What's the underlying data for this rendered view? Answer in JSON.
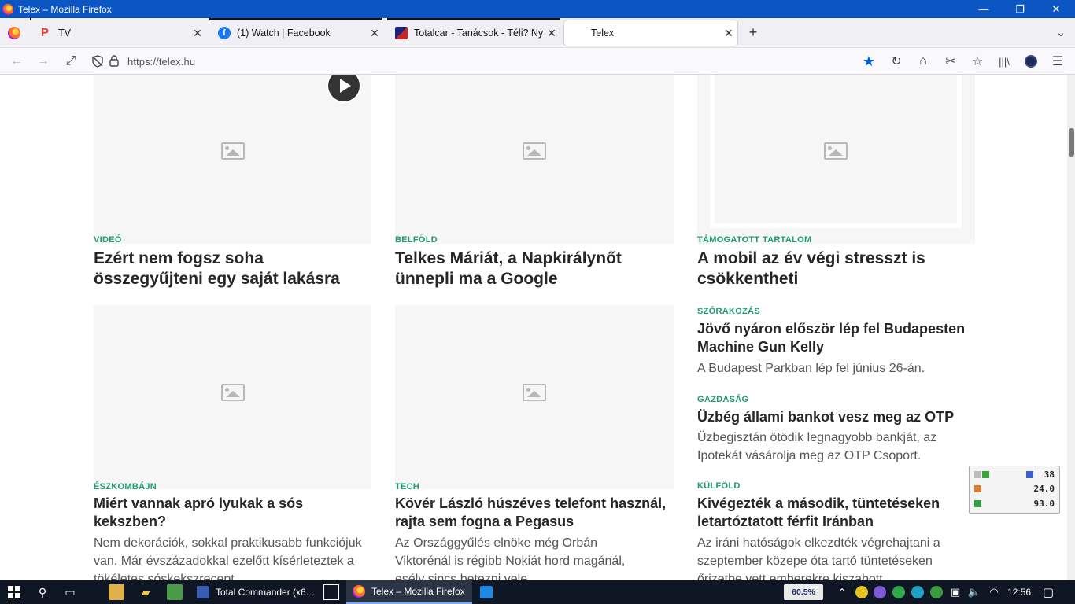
{
  "window": {
    "title": "Telex – Mozilla Firefox",
    "controls": {
      "minimize": "—",
      "restore": "❐",
      "close": "✕"
    }
  },
  "tabs": [
    {
      "title": "TV",
      "favicon": "p-logo-icon"
    },
    {
      "title": "(1) Watch | Facebook",
      "favicon": "facebook-icon"
    },
    {
      "title": "Totalcar - Tanácsok - Téli? Nyári",
      "favicon": "totalcar-icon"
    },
    {
      "title": "Telex",
      "favicon": "telex-icon",
      "active": true
    }
  ],
  "navbar": {
    "url": "https://telex.hu",
    "bookmarked": true,
    "accent": "#0060df"
  },
  "articles": [
    {
      "category": "VIDEÓ",
      "headline": "Ezért nem fogsz soha összegyűjteni egy saját lakásra",
      "has_video": true
    },
    {
      "category": "BELFÖLD",
      "headline": "Telkes Máriát, a Napkirálynőt ünnepli ma a Google"
    },
    {
      "category": "TÁMOGATOTT TARTALOM",
      "headline": "A mobil az év végi stresszt is csökkentheti"
    },
    {
      "category": "SZÓRAKOZÁS",
      "headline": "Jövő nyáron először lép fel Budapesten Machine Gun Kelly",
      "lead": "A Budapest Parkban lép fel június 26-án."
    },
    {
      "category": "GAZDASÁG",
      "headline": "Üzbég állami bankot vesz meg az OTP",
      "lead": "Üzbegisztán ötödik legnagyobb bankját, az Ipotekát vásárolja meg az OTP Csoport."
    },
    {
      "category": "ÉSZKOMBÁJN",
      "headline": "Miért vannak apró lyukak a sós kekszben?",
      "lead": "Nem dekorációk, sokkal praktikusabb funkciójuk van. Már évszázadokkal ezelőtt kísérleteztek a tökéletes sóskekszrecept"
    },
    {
      "category": "TECH",
      "headline": "Kövér László húszéves telefont használ, rajta sem fogna a Pegasus",
      "lead": "Az Országgyűlés elnöke még Orbán Viktorénál is régibb Nokiát hord magánál, esély sincs betezni vele"
    },
    {
      "category": "KÜLFÖLD",
      "headline": "Kivégezték a második, tüntetéseken letartóztatott férfit Iránban",
      "lead": "Az iráni hatóságok elkezdték végrehajtani a szeptember közepe óta tartó tüntetéseken őrizetbe vett emberekre kiszabott"
    }
  ],
  "gadget": {
    "values": [
      "38",
      "24.0",
      "93.0"
    ]
  },
  "taskbar": {
    "apps": [
      {
        "label": "Total Commander (x6…",
        "active": false
      },
      {
        "label": "Telex – Mozilla Firefox",
        "active": true
      }
    ],
    "battery": "60.5%",
    "clock": "12:56"
  },
  "colors": {
    "category_green": "#1f9b6d",
    "titlebar": "#0b56c2",
    "taskbar": "#0f1724"
  }
}
